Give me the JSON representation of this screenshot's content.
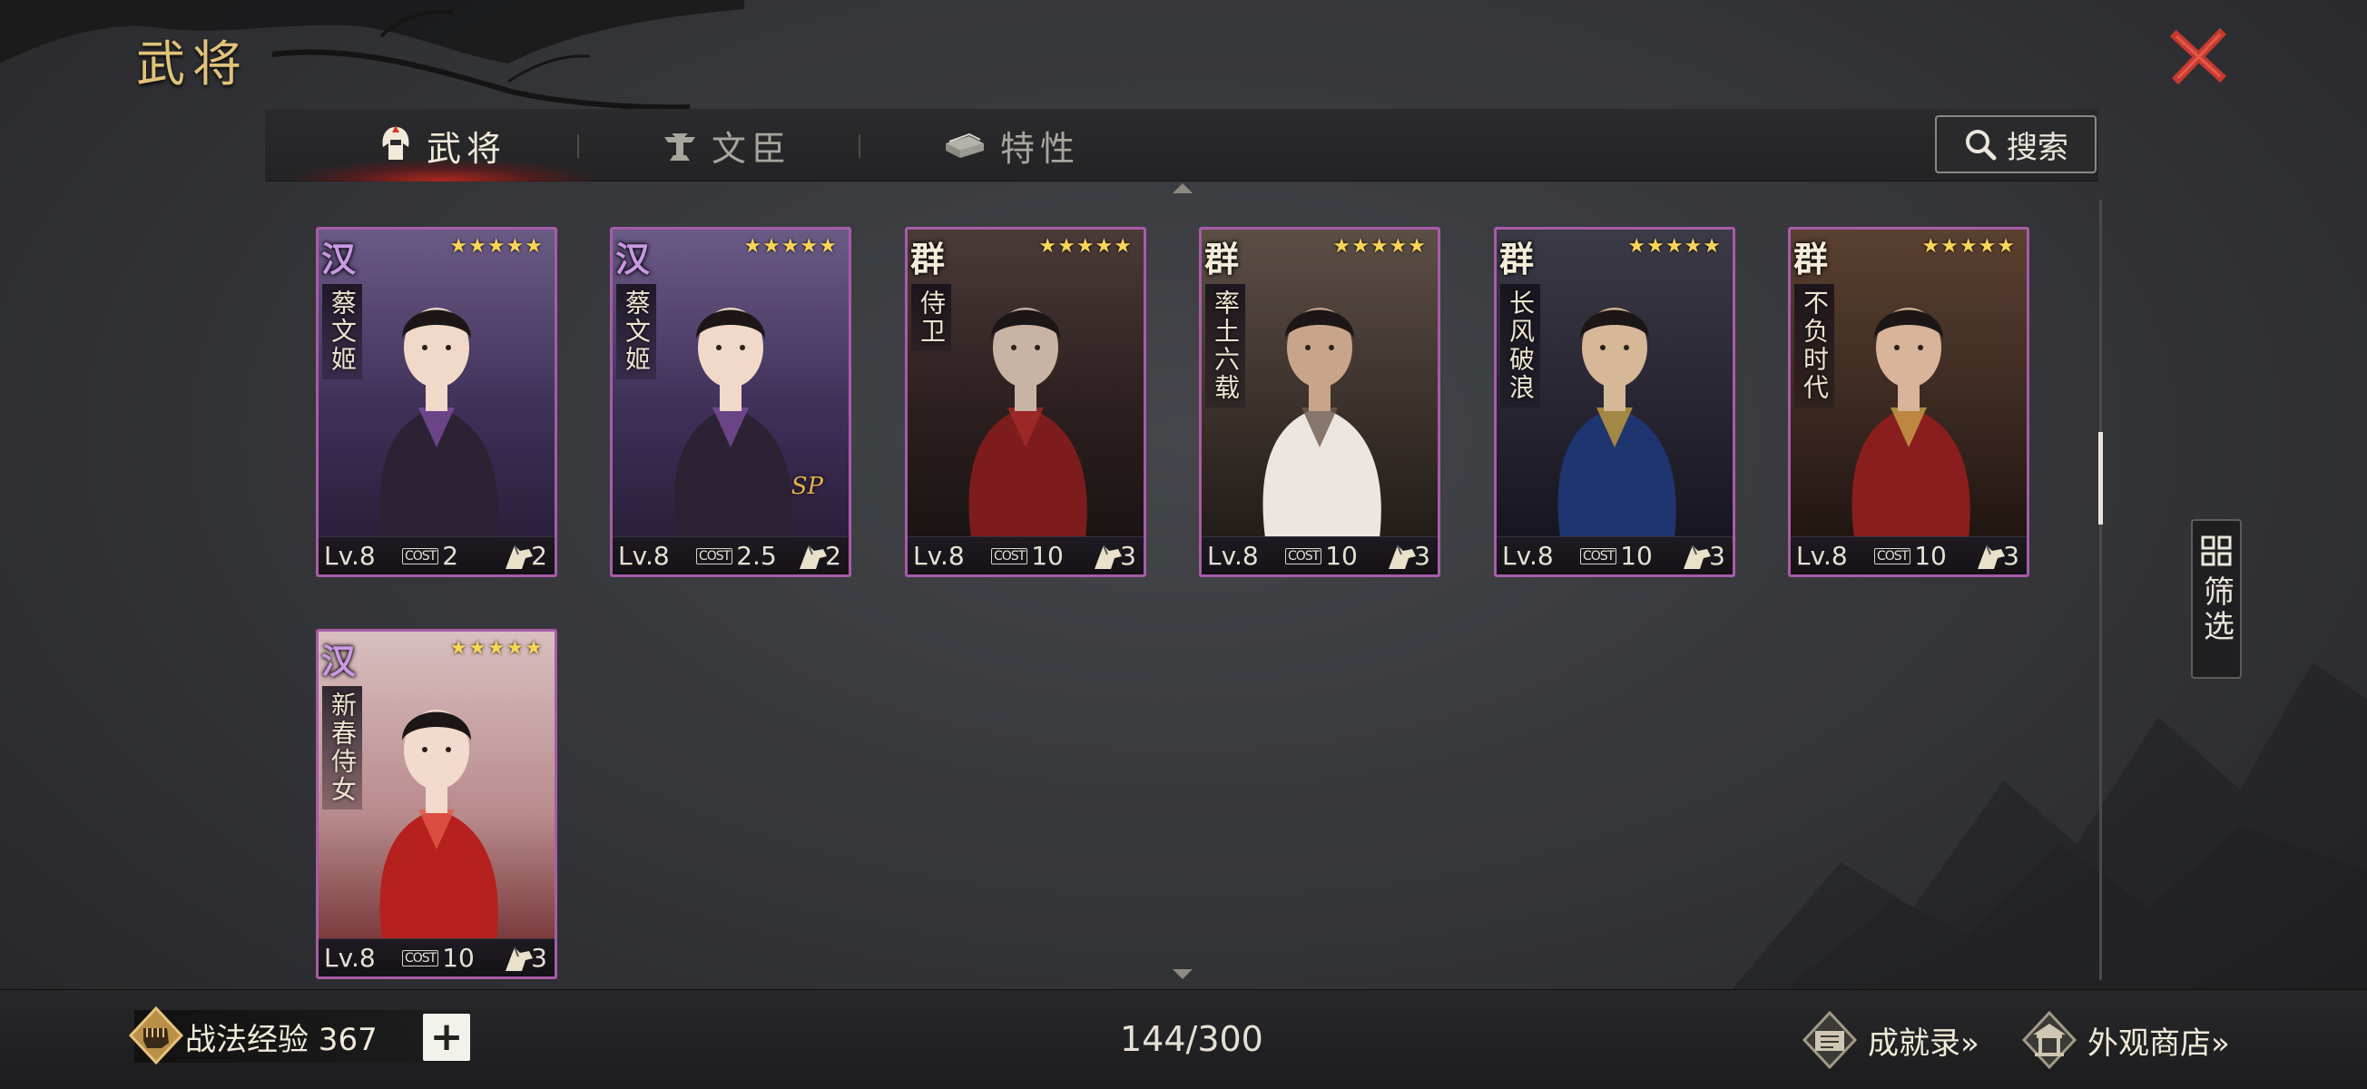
{
  "page": {
    "title": "武将"
  },
  "tabs": [
    {
      "label": "武将",
      "icon": "helmet-icon",
      "active": true
    },
    {
      "label": "文臣",
      "icon": "scholar-hat-icon",
      "active": false
    },
    {
      "label": "特性",
      "icon": "book-stack-icon",
      "active": false
    }
  ],
  "search": {
    "label": "搜索",
    "icon": "search-icon"
  },
  "filter": {
    "label": "筛选",
    "icon": "grid-icon"
  },
  "cards": [
    {
      "faction": "汉",
      "name": "蔡文姬",
      "stars": "★★★★★",
      "level": "Lv.8",
      "cost_label": "COST",
      "cost": "2",
      "troop": "2",
      "sp": "",
      "palette": "purple"
    },
    {
      "faction": "汉",
      "name": "蔡文姬",
      "stars": "★★★★★",
      "level": "Lv.8",
      "cost_label": "COST",
      "cost": "2.5",
      "troop": "2",
      "sp": "SP",
      "palette": "purple"
    },
    {
      "faction": "群",
      "name": "侍卫",
      "stars": "★★★★★",
      "level": "Lv.8",
      "cost_label": "COST",
      "cost": "10",
      "troop": "3",
      "sp": "",
      "palette": "red"
    },
    {
      "faction": "群",
      "name": "率土六载",
      "stars": "★★★★★",
      "level": "Lv.8",
      "cost_label": "COST",
      "cost": "10",
      "troop": "3",
      "sp": "",
      "palette": "brown"
    },
    {
      "faction": "群",
      "name": "长风破浪",
      "stars": "★★★★★",
      "level": "Lv.8",
      "cost_label": "COST",
      "cost": "10",
      "troop": "3",
      "sp": "",
      "palette": "blue"
    },
    {
      "faction": "群",
      "name": "不负时代",
      "stars": "★★★★★",
      "level": "Lv.8",
      "cost_label": "COST",
      "cost": "10",
      "troop": "3",
      "sp": "",
      "palette": "crimson"
    },
    {
      "faction": "汉",
      "name": "新春侍女",
      "stars": "★★★★★",
      "level": "Lv.8",
      "cost_label": "COST",
      "cost": "10",
      "troop": "3",
      "sp": "",
      "palette": "festive"
    }
  ],
  "footer": {
    "exp_label": "战法经验 367",
    "plus": "+",
    "count": "144/300",
    "achievements": "成就录»",
    "shop": "外观商店»"
  },
  "colors": {
    "title_gold": "#e0c27a",
    "card_border": "#a75ca8",
    "star": "#f8d457",
    "tab_glow": "#c8281e"
  }
}
